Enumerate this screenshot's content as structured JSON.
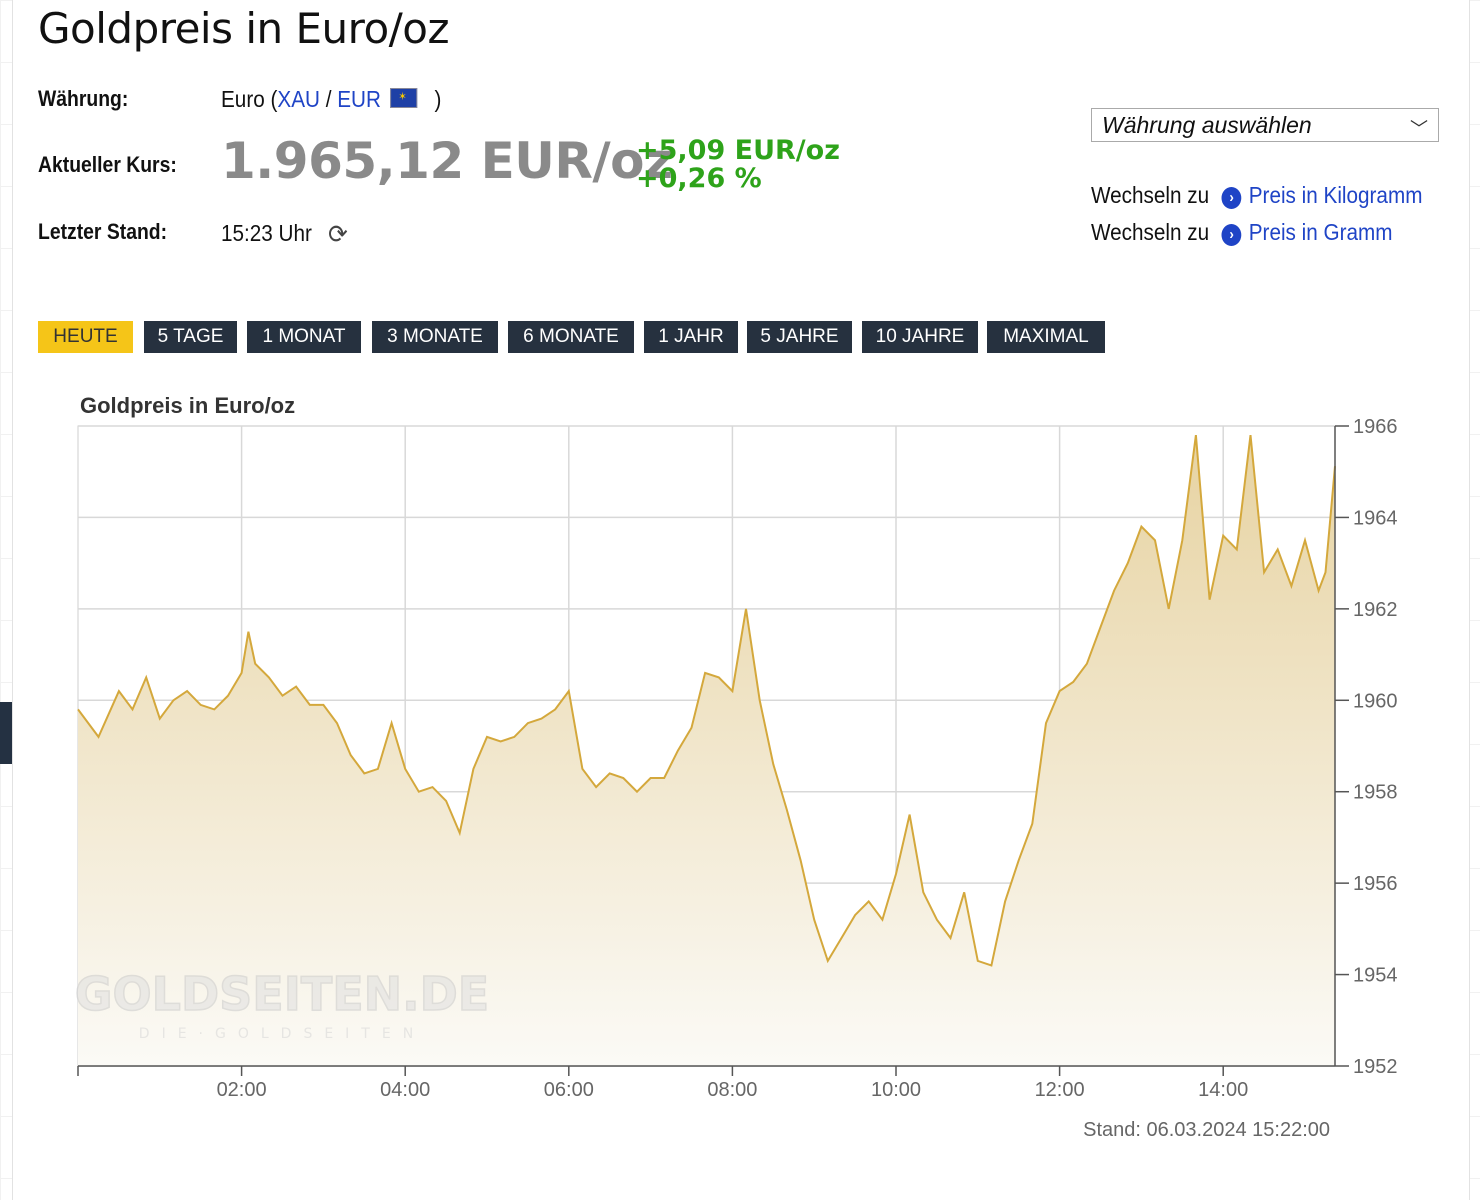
{
  "page": {
    "title": "Goldpreis in Euro/oz",
    "labels": {
      "currency": "Währung:",
      "current": "Aktueller Kurs:",
      "last": "Letzter Stand:"
    },
    "currency": {
      "name": "Euro",
      "open": "(",
      "xau": "XAU",
      "sep": "/",
      "eur": "EUR",
      "close": ")"
    },
    "current_price": "1.965,12 EUR/oz",
    "change_abs": "+5,09 EUR/oz",
    "change_pct": "+0,26 %",
    "last_time": "15:23 Uhr",
    "select_placeholder": "Währung auswählen",
    "switch_prefix": "Wechseln zu",
    "switch_links": [
      "Preis in Kilogramm",
      "Preis in Gramm"
    ],
    "tabs": [
      "HEUTE",
      "5 TAGE",
      "1 MONAT",
      "3 MONATE",
      "6 MONATE",
      "1 JAHR",
      "5 JAHRE",
      "10 JAHRE",
      "MAXIMAL"
    ],
    "active_tab": 0,
    "watermark": {
      "main": "GOLDSEITEN.DE",
      "sub": "DIE·GOLDSEITEN"
    },
    "stand": "Stand: 06.03.2024 15:22:00",
    "colors": {
      "gold_line": "#d4a83c",
      "fill_top": "#e7d3a2",
      "green": "#2ea31a",
      "tab_dark": "#26313f",
      "tab_active": "#f5c518",
      "link": "#1f44c6"
    }
  },
  "chart_data": {
    "type": "area",
    "title": "Goldpreis in Euro/oz",
    "xlabel": "",
    "ylabel": "",
    "x_ticks": [
      "02:00",
      "04:00",
      "06:00",
      "08:00",
      "10:00",
      "12:00",
      "14:00"
    ],
    "y_ticks": [
      1952,
      1954,
      1956,
      1958,
      1960,
      1962,
      1964,
      1966
    ],
    "xlim": [
      "00:00",
      "15:22"
    ],
    "ylim": [
      1952,
      1966
    ],
    "grid": true,
    "series": [
      {
        "x": [
          "00:00",
          "00:15",
          "00:30",
          "00:40",
          "00:50",
          "01:00",
          "01:10",
          "01:20",
          "01:30",
          "01:40",
          "01:50",
          "02:00",
          "02:05",
          "02:10",
          "02:20",
          "02:30",
          "02:40",
          "02:50",
          "03:00",
          "03:10",
          "03:20",
          "03:30",
          "03:40",
          "03:50",
          "04:00",
          "04:10",
          "04:20",
          "04:30",
          "04:40",
          "04:50",
          "05:00",
          "05:10",
          "05:20",
          "05:30",
          "05:40",
          "05:50",
          "06:00",
          "06:10",
          "06:20",
          "06:30",
          "06:40",
          "06:50",
          "07:00",
          "07:10",
          "07:20",
          "07:30",
          "07:40",
          "07:50",
          "08:00",
          "08:10",
          "08:20",
          "08:30",
          "08:40",
          "08:50",
          "09:00",
          "09:10",
          "09:20",
          "09:30",
          "09:40",
          "09:50",
          "10:00",
          "10:10",
          "10:20",
          "10:30",
          "10:40",
          "10:50",
          "11:00",
          "11:10",
          "11:20",
          "11:30",
          "11:40",
          "11:50",
          "12:00",
          "12:10",
          "12:20",
          "12:30",
          "12:40",
          "12:50",
          "13:00",
          "13:10",
          "13:20",
          "13:30",
          "13:40",
          "13:50",
          "14:00",
          "14:10",
          "14:20",
          "14:30",
          "14:40",
          "14:50",
          "15:00",
          "15:10",
          "15:15",
          "15:22"
        ],
        "y": [
          1959.8,
          1959.2,
          1960.2,
          1959.8,
          1960.5,
          1959.6,
          1960.0,
          1960.2,
          1959.9,
          1959.8,
          1960.1,
          1960.6,
          1961.5,
          1960.8,
          1960.5,
          1960.1,
          1960.3,
          1959.9,
          1959.9,
          1959.5,
          1958.8,
          1958.4,
          1958.5,
          1959.5,
          1958.5,
          1958.0,
          1958.1,
          1957.8,
          1957.1,
          1958.5,
          1959.2,
          1959.1,
          1959.2,
          1959.5,
          1959.6,
          1959.8,
          1960.2,
          1958.5,
          1958.1,
          1958.4,
          1958.3,
          1958.0,
          1958.3,
          1958.3,
          1958.9,
          1959.4,
          1960.6,
          1960.5,
          1960.2,
          1962.0,
          1960.0,
          1958.6,
          1957.6,
          1956.5,
          1955.2,
          1954.3,
          1954.8,
          1955.3,
          1955.6,
          1955.2,
          1956.2,
          1957.5,
          1955.8,
          1955.2,
          1954.8,
          1955.8,
          1954.3,
          1954.2,
          1955.6,
          1956.5,
          1957.3,
          1959.5,
          1960.2,
          1960.4,
          1960.8,
          1961.6,
          1962.4,
          1963.0,
          1963.8,
          1963.5,
          1962.0,
          1963.5,
          1965.8,
          1962.2,
          1963.6,
          1963.3,
          1965.8,
          1962.8,
          1963.3,
          1962.5,
          1963.5,
          1962.4,
          1962.8,
          1965.12
        ]
      }
    ]
  }
}
